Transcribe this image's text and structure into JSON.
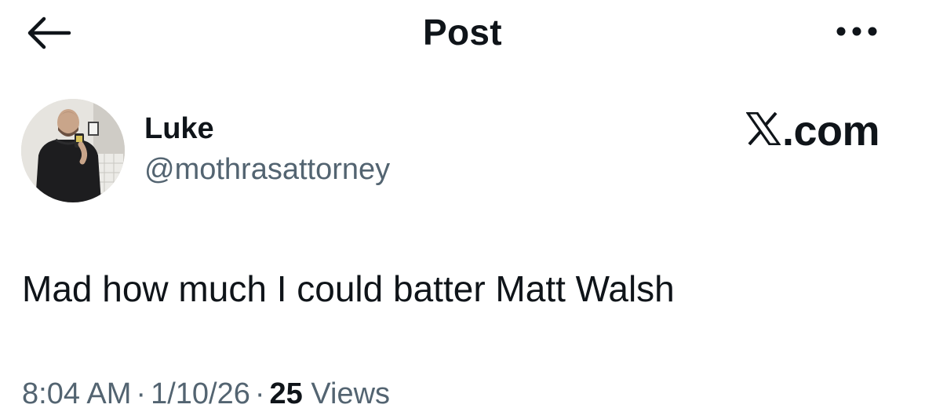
{
  "header": {
    "title": "Post",
    "back_icon": "arrow-left-icon",
    "more_icon": "more-horizontal-icon"
  },
  "author": {
    "display_name": "Luke",
    "handle": "@mothrasattorney",
    "avatar": "profile-photo"
  },
  "source": {
    "logo_text": ".com",
    "logo_icon": "x-logo-icon"
  },
  "post": {
    "text": "Mad how much I could batter Matt Walsh"
  },
  "meta": {
    "time": "8:04 AM",
    "date": "1/10/26",
    "separator": "·",
    "views_count": "25",
    "views_label": "Views"
  },
  "colors": {
    "text_primary": "#0f1419",
    "text_secondary": "#536471",
    "background": "#ffffff"
  }
}
